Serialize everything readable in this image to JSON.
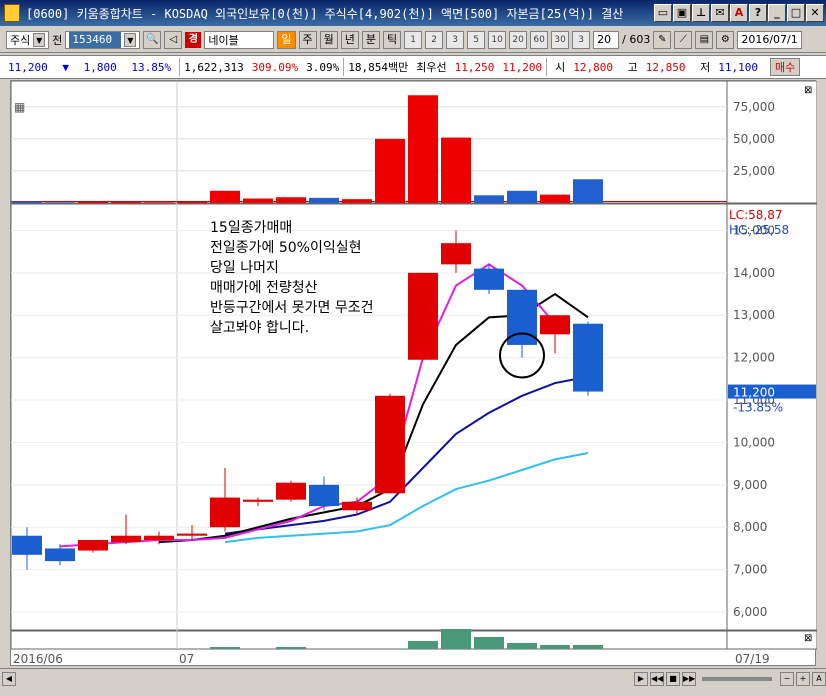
{
  "window": {
    "title": "[0600] 키움종합차트 - KOSDAQ 외국인보유[0(천)] 주식수[4,902(천)] 액면[500] 자본금[25(억)] 결산"
  },
  "toolbar": {
    "market": "주식",
    "code_label": "전",
    "code": "153460",
    "gbadge": "경",
    "stock_name": "네이블",
    "periods": [
      "일",
      "주",
      "월",
      "년",
      "분",
      "틱"
    ],
    "active_period": "일",
    "nums": [
      "1",
      "2",
      "3",
      "5",
      "10",
      "20",
      "60",
      "30",
      "3"
    ],
    "count": "20",
    "total": "/ 603",
    "date": "2016/07/1"
  },
  "info": {
    "price": "11,200",
    "change_arrow": "▼",
    "change": "1,800",
    "change_pct": "13.85%",
    "volume": "1,622,313",
    "vol_ratio": "309.09%",
    "turnover": "3.09%",
    "amount": "18,854백만",
    "best_label": "최우선",
    "best_ask": "11,250",
    "best_bid": "11,200",
    "open_label": "시",
    "open": "12,800",
    "high_label": "고",
    "high": "12,850",
    "low_label": "저",
    "low": "11,100",
    "buy": "매수"
  },
  "annotation": {
    "lines": [
      "15일종가매매",
      "전일종가에 50%이익실현",
      "당일 나머지",
      "매매가에 전량청산",
      "반등구간에서 못가면 무조건",
      "살고봐야 합니다."
    ]
  },
  "legend": {
    "lc": "LC:58,87",
    "hc": "HC:-25,58",
    "last_price": "11,200",
    "last_pct": "-13.85%"
  },
  "axis": {
    "date_start": "2016/06",
    "date_mid": "07",
    "date_end": "07/19"
  },
  "chart_data": {
    "type": "candlestick",
    "price_ticks": [
      6000,
      7000,
      8000,
      9000,
      10000,
      11000,
      12000,
      13000,
      14000,
      15000
    ],
    "volume_ticks": [
      25000,
      50000,
      75000
    ],
    "candles": [
      {
        "o": 7800,
        "h": 8000,
        "l": 7000,
        "c": 7350
      },
      {
        "o": 7500,
        "h": 7600,
        "l": 7100,
        "c": 7200
      },
      {
        "o": 7450,
        "h": 7700,
        "l": 7400,
        "c": 7700
      },
      {
        "o": 7650,
        "h": 8300,
        "l": 7600,
        "c": 7800
      },
      {
        "o": 7700,
        "h": 7900,
        "l": 7600,
        "c": 7800
      },
      {
        "o": 7800,
        "h": 8050,
        "l": 7700,
        "c": 7850
      },
      {
        "o": 8000,
        "h": 9400,
        "l": 7900,
        "c": 8700
      },
      {
        "o": 8600,
        "h": 8700,
        "l": 8500,
        "c": 8650
      },
      {
        "o": 8650,
        "h": 9100,
        "l": 8600,
        "c": 9050
      },
      {
        "o": 9000,
        "h": 9200,
        "l": 8400,
        "c": 8500
      },
      {
        "o": 8400,
        "h": 8700,
        "l": 8300,
        "c": 8600
      },
      {
        "o": 8800,
        "h": 11150,
        "l": 8800,
        "c": 11100
      },
      {
        "o": 11950,
        "h": 14000,
        "l": 11950,
        "c": 14000
      },
      {
        "o": 14200,
        "h": 15000,
        "l": 14000,
        "c": 14700
      },
      {
        "o": 14100,
        "h": 14200,
        "l": 13500,
        "c": 13600
      },
      {
        "o": 13600,
        "h": 13600,
        "l": 12000,
        "c": 12300
      },
      {
        "o": 12550,
        "h": 13000,
        "l": 12100,
        "c": 13000
      },
      {
        "o": 12800,
        "h": 12850,
        "l": 11100,
        "c": 11200
      }
    ],
    "volumes": [
      1200,
      600,
      800,
      1100,
      600,
      800,
      9500,
      3500,
      4500,
      4000,
      3000,
      50000,
      84000,
      51000,
      6000,
      9500,
      6500,
      18500
    ],
    "ma_magenta": [
      null,
      7550,
      7600,
      7650,
      7700,
      7700,
      7750,
      7950,
      8150,
      8500,
      8600,
      9200,
      12000,
      13700,
      14200,
      13700,
      12800,
      null
    ],
    "ma_black": [
      null,
      null,
      null,
      null,
      7650,
      7700,
      7800,
      8000,
      8200,
      8350,
      8500,
      8900,
      10900,
      12300,
      12950,
      13000,
      13500,
      12950
    ],
    "ma_navy": [
      null,
      null,
      null,
      null,
      null,
      null,
      7850,
      7950,
      8050,
      8150,
      8300,
      8600,
      9400,
      10200,
      10700,
      11100,
      11400,
      11550
    ],
    "ma_cyan": [
      null,
      null,
      null,
      null,
      null,
      null,
      7650,
      7750,
      7800,
      7850,
      7900,
      8050,
      8500,
      8900,
      9100,
      9350,
      9600,
      9750
    ]
  }
}
